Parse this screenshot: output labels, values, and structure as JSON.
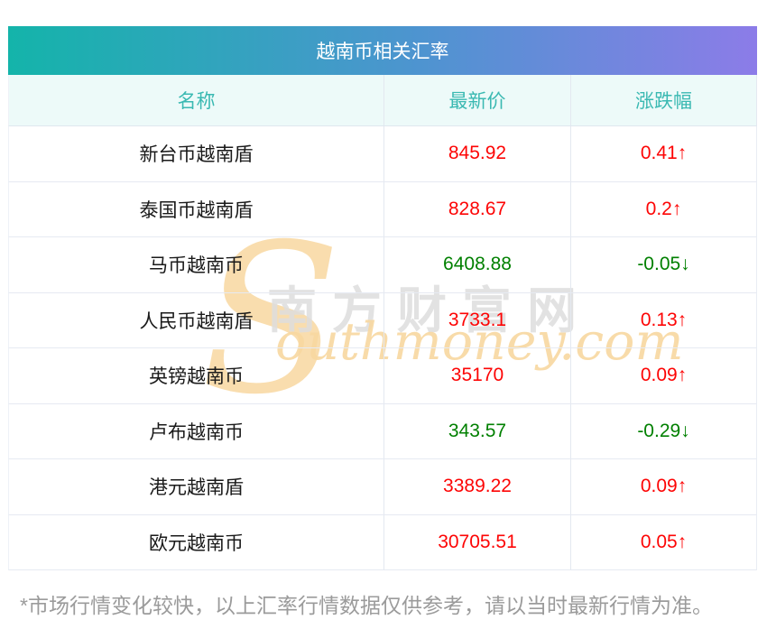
{
  "chart_data": {
    "type": "table",
    "title": "越南币相关汇率",
    "columns": [
      "名称",
      "最新价",
      "涨跌幅"
    ],
    "rows": [
      {
        "name": "新台币越南盾",
        "price": "845.92",
        "change": "0.41↑",
        "trend": "up"
      },
      {
        "name": "泰国币越南盾",
        "price": "828.67",
        "change": "0.2↑",
        "trend": "up"
      },
      {
        "name": "马币越南币",
        "price": "6408.88",
        "change": "-0.05↓",
        "trend": "down"
      },
      {
        "name": "人民币越南盾",
        "price": "3733.1",
        "change": "0.13↑",
        "trend": "up"
      },
      {
        "name": "英镑越南币",
        "price": "35170",
        "change": "0.09↑",
        "trend": "up"
      },
      {
        "name": "卢布越南币",
        "price": "343.57",
        "change": "-0.29↓",
        "trend": "down"
      },
      {
        "name": "港元越南盾",
        "price": "3389.22",
        "change": "0.09↑",
        "trend": "up"
      },
      {
        "name": "欧元越南币",
        "price": "30705.51",
        "change": "0.05↑",
        "trend": "up"
      }
    ],
    "legend_position": "none",
    "grid": true
  },
  "watermark": {
    "big_letter": "S",
    "cn_text": "南方财富网",
    "en_text": "outhmoney.com"
  },
  "footer": {
    "disclaimer": "*市场行情变化较快，以上汇率行情数据仅供参考，请以当时最新行情为准。"
  },
  "colors": {
    "gradient_start": "#14b4aa",
    "gradient_mid": "#4e94d0",
    "gradient_end": "#8c7ce8",
    "header_bg": "#edfaf9",
    "header_text": "#3ab9b2",
    "rise_red": "#fd0505",
    "fall_green": "#018001",
    "watermark_peach": "#f8d8a0",
    "watermark_gray": "#dedede",
    "disclaimer_gray": "#9b9b9b"
  }
}
